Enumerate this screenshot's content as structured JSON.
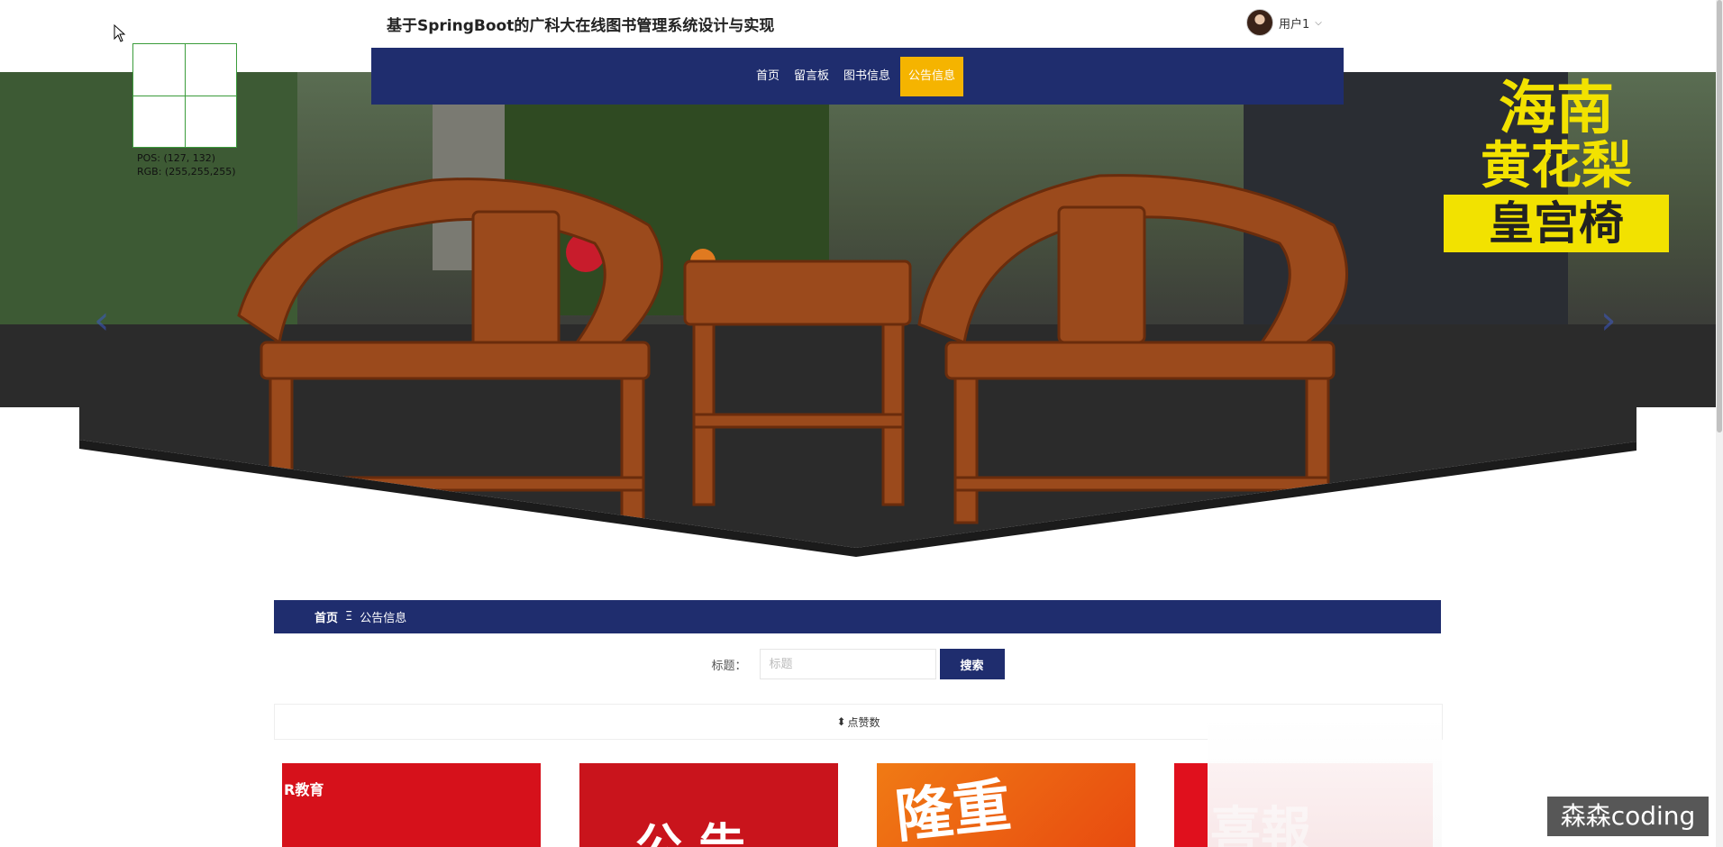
{
  "header": {
    "site_title": "基于SpringBoot的广科大在线图书管理系统设计与实现",
    "user_name": "用户1",
    "chevron": "⌵"
  },
  "nav": {
    "items": [
      {
        "label": "首页"
      },
      {
        "label": "留言板"
      },
      {
        "label": "图书信息"
      },
      {
        "label": "公告信息",
        "active": true
      }
    ],
    "accent_color": "#1f2d6e",
    "active_color": "#f5b400"
  },
  "banner": {
    "text_lines": [
      "海南",
      "黄花梨",
      "皇宫椅"
    ],
    "prev_icon": "chevron-left-icon",
    "next_icon": "chevron-right-icon"
  },
  "picker": {
    "pos": "POS:  (127, 132)",
    "rgb": "RGB:  (255,255,255)"
  },
  "breadcrumb": {
    "home": "首页",
    "separator": "Ξ",
    "current": "公告信息"
  },
  "search": {
    "label": "标题：",
    "placeholder": "标题",
    "button": "搜索"
  },
  "sort": {
    "icon": "⬍",
    "label": "点赞数"
  },
  "cards": [
    {
      "text": "R教育"
    },
    {
      "text": "公  告"
    },
    {
      "text": "隆重"
    },
    {
      "text": "喜報"
    }
  ],
  "watermark": "森森coding"
}
